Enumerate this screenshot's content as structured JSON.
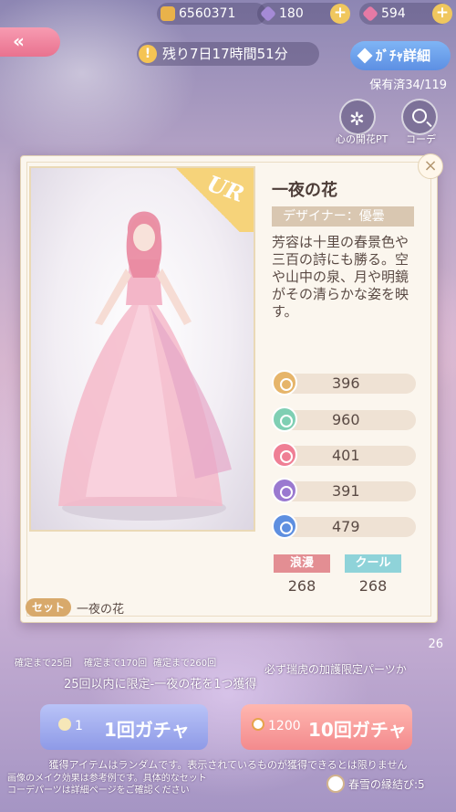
{
  "currency": {
    "gold": "6560371",
    "diamond_purple": "180",
    "diamond_pink": "594"
  },
  "back_label": "«",
  "timer_text": "残り7日17時間51分",
  "gacha_detail_label": "ｶﾞﾁｬ詳細",
  "owned_text": "保有済34/119",
  "side_buttons": {
    "bond": "心の開花PT",
    "coord": "コーデ"
  },
  "item": {
    "rarity": "UR",
    "name": "一夜の花",
    "designer": "デザイナー：優曇",
    "description": "芳容は十里の春景色や三百の詩にも勝る。空や山中の泉、月や明鏡がその清らかな姿を映す。",
    "stats": [
      {
        "key": "elegant",
        "value": "396",
        "color": "#e6b56a"
      },
      {
        "key": "fresh",
        "value": "960",
        "color": "#7fcfb3"
      },
      {
        "key": "sweet",
        "value": "401",
        "color": "#ef7f95"
      },
      {
        "key": "sexy",
        "value": "391",
        "color": "#9a79d0"
      },
      {
        "key": "cool",
        "value": "479",
        "color": "#5e8fe0"
      }
    ],
    "tags": [
      {
        "label": "浪漫",
        "value": "268"
      },
      {
        "label": "クール",
        "value": "268"
      }
    ],
    "set_badge": "セット",
    "set_name": "一夜の花"
  },
  "guarantee": {
    "g1": "確定まで25回",
    "g2": "確定まで170回",
    "g3": "確定まで260回",
    "side_label": "26",
    "line1": "必ず瑞虎の加護限定パーツか",
    "line2": "25回以内に限定-一夜の花を1つ獲得"
  },
  "pull_single": {
    "cost": "1",
    "label": "1回ガチャ"
  },
  "pull_ten": {
    "cost": "1200",
    "label": "10回ガチャ"
  },
  "notice": "獲得アイテムはランダムです。表示されているものが獲得できるとは限りません",
  "note_line1": "画像のメイク効果は参考例です。具体的なセット",
  "note_line2": "コーデパーツは詳細ページをご確認ください",
  "fate_text": "春雪の縁結び:5"
}
